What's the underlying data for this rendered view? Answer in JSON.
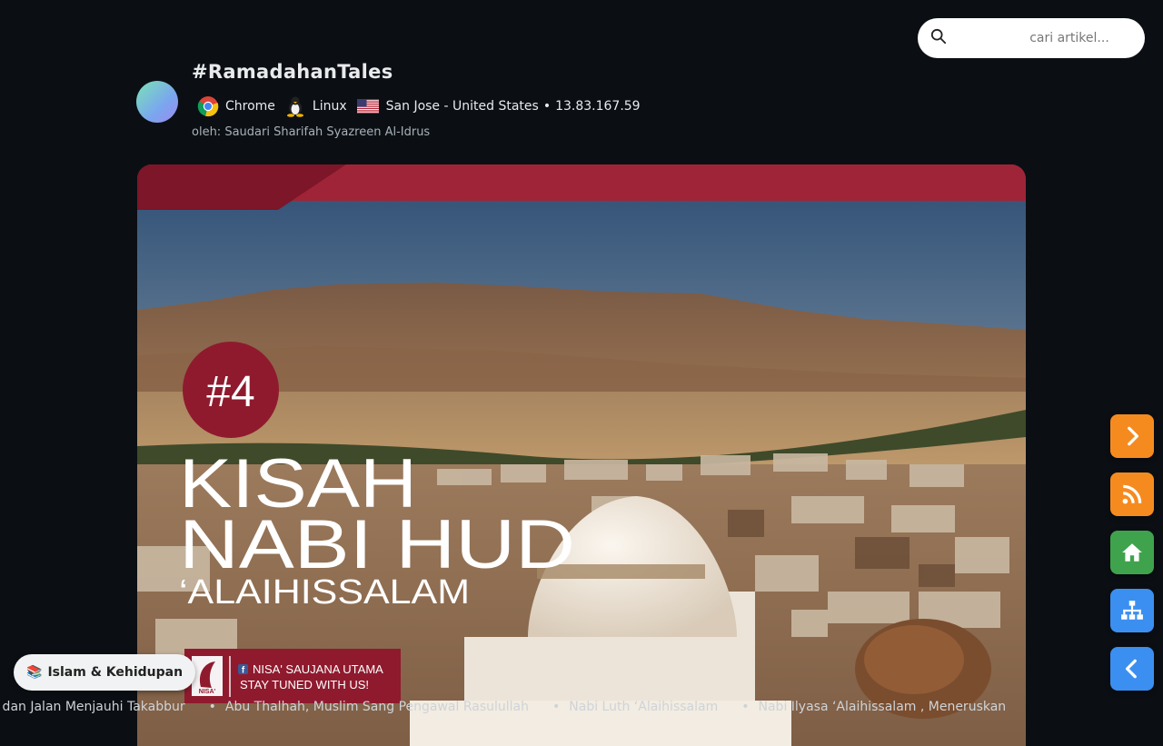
{
  "search": {
    "placeholder": "cari artikel..."
  },
  "post": {
    "title": "#RamadahanTales",
    "browser": "Chrome",
    "os": "Linux",
    "location": "San Jose - United States",
    "separator": "•",
    "ip": "13.83.167.59",
    "byline": "oleh: Saudari Sharifah Syazreen Al-Idrus"
  },
  "hero": {
    "badge": "#4",
    "line1": "KISAH",
    "line2": "NABI HUD",
    "line3": "‘ALAIHISSALAM",
    "brand_logo": "NISA'",
    "brand_name": "NISA' SAUJANA UTAMA",
    "brand_tagline": "STAY TUNED WITH US!"
  },
  "category": {
    "icon": "books-icon",
    "label": "Islam & Kehidupan"
  },
  "ticker": [
    "h Sombong - Tafsir, Bahaya, dan Jalan Menjauhi Takabbur",
    "Abu Thalhah, Muslim Sang Pengawal Rasulullah",
    "Nabi Luth ‘Alaihissalam",
    "Nabi Ilyasa ‘Alaihissalam , Meneruskan"
  ],
  "fabs": [
    {
      "name": "next",
      "color": "#f58b1f"
    },
    {
      "name": "rss",
      "color": "#f58b1f"
    },
    {
      "name": "home",
      "color": "#3fa34d"
    },
    {
      "name": "sitemap",
      "color": "#3b8ff0"
    },
    {
      "name": "back",
      "color": "#3b8ff0"
    }
  ],
  "colors": {
    "background": "#0b0f14",
    "banner": "#a02438",
    "badge": "#8f1a2e"
  }
}
